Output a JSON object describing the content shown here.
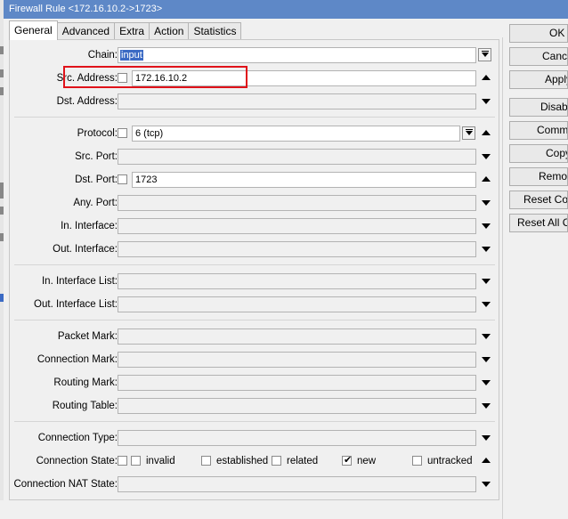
{
  "window": {
    "title": "Firewall Rule <172.16.10.2->1723>"
  },
  "tabs": [
    "General",
    "Advanced",
    "Extra",
    "Action",
    "Statistics"
  ],
  "fields": {
    "chain": {
      "label": "Chain:",
      "value": "input"
    },
    "src_address": {
      "label": "Src. Address:",
      "value": "172.16.10.2"
    },
    "dst_address": {
      "label": "Dst. Address:",
      "value": ""
    },
    "protocol": {
      "label": "Protocol:",
      "value": "6 (tcp)"
    },
    "src_port": {
      "label": "Src. Port:",
      "value": ""
    },
    "dst_port": {
      "label": "Dst. Port:",
      "value": "1723"
    },
    "any_port": {
      "label": "Any. Port:",
      "value": ""
    },
    "in_interface": {
      "label": "In. Interface:",
      "value": ""
    },
    "out_interface": {
      "label": "Out. Interface:",
      "value": ""
    },
    "in_interface_list": {
      "label": "In. Interface List:",
      "value": ""
    },
    "out_interface_list": {
      "label": "Out. Interface List:",
      "value": ""
    },
    "packet_mark": {
      "label": "Packet Mark:",
      "value": ""
    },
    "connection_mark": {
      "label": "Connection Mark:",
      "value": ""
    },
    "routing_mark": {
      "label": "Routing Mark:",
      "value": ""
    },
    "routing_table": {
      "label": "Routing Table:",
      "value": ""
    },
    "connection_type": {
      "label": "Connection Type:",
      "value": ""
    },
    "connection_state": {
      "label": "Connection State:",
      "options": [
        {
          "label": "invalid",
          "checked": false
        },
        {
          "label": "established",
          "checked": false
        },
        {
          "label": "related",
          "checked": false
        },
        {
          "label": "new",
          "checked": true
        },
        {
          "label": "untracked",
          "checked": false
        }
      ]
    },
    "connection_nat_state": {
      "label": "Connection NAT State:",
      "value": ""
    }
  },
  "buttons": {
    "ok": "OK",
    "cancel": "Cancel",
    "apply": "Apply",
    "disable": "Disable",
    "comment": "Comment",
    "copy": "Copy",
    "remove": "Remove",
    "reset_counters": "Reset Counters",
    "reset_all_counters": "Reset All Counters"
  },
  "colors": {
    "titlebar": "#5e88c7",
    "selection": "#3b6ac4",
    "highlight": "#e0121a"
  }
}
